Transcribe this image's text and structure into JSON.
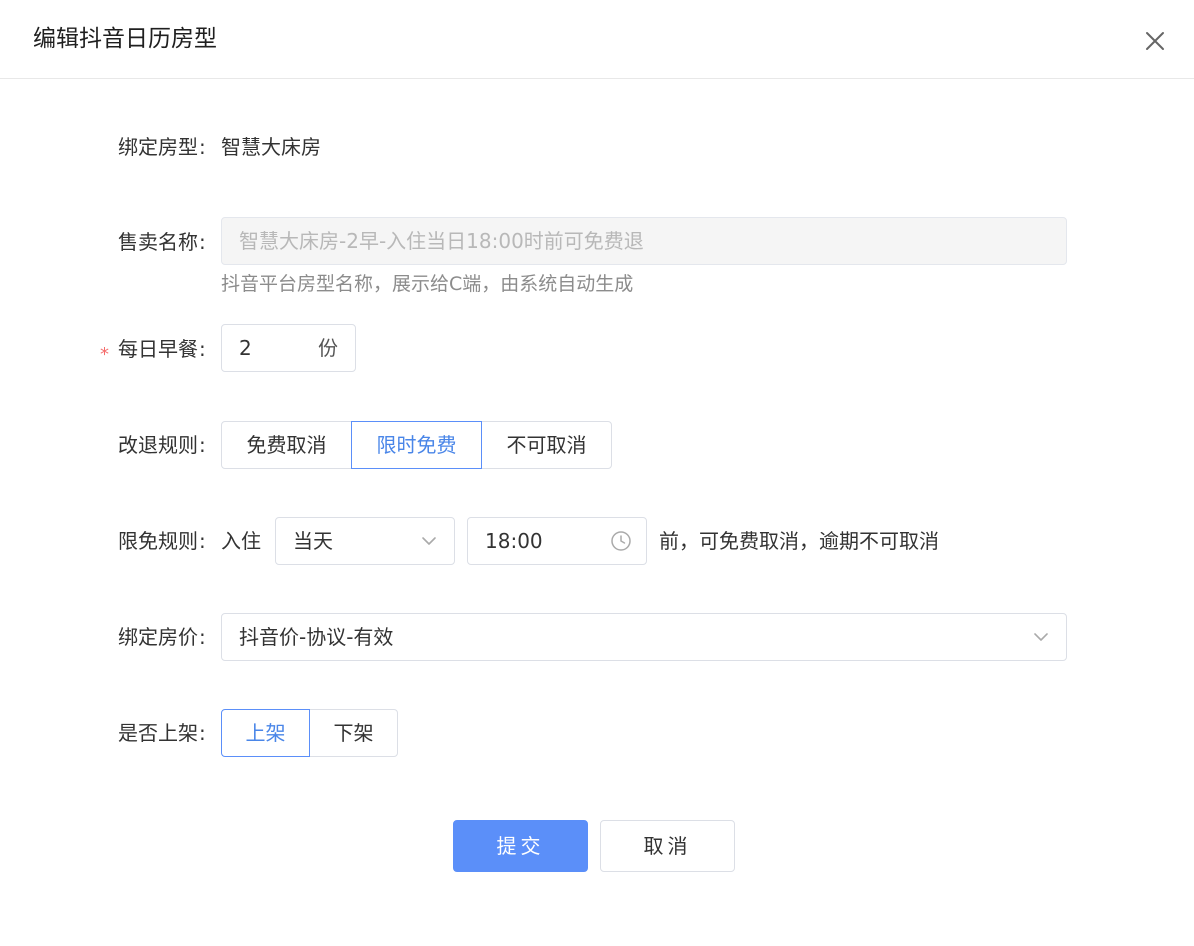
{
  "dialog": {
    "title": "编辑抖音日历房型"
  },
  "form": {
    "room_type": {
      "label": "绑定房型",
      "value": "智慧大床房"
    },
    "sale_name": {
      "label": "售卖名称",
      "placeholder": "智慧大床房-2早-入住当日18:00时前可免费退",
      "hint": "抖音平台房型名称，展示给C端，由系统自动生成"
    },
    "breakfast": {
      "label": "每日早餐",
      "required_mark": "*",
      "value": "2",
      "unit": "份"
    },
    "cancel_rule": {
      "label": "改退规则",
      "options": [
        "免费取消",
        "限时免费",
        "不可取消"
      ],
      "selected": "限时免费"
    },
    "free_rule": {
      "label": "限免规则",
      "prefix": "入住",
      "day_value": "当天",
      "time_value": "18:00",
      "suffix": "前，可免费取消，逾期不可取消"
    },
    "price": {
      "label": "绑定房价",
      "value": "抖音价-协议-有效"
    },
    "listing": {
      "label": "是否上架",
      "options": [
        "上架",
        "下架"
      ],
      "selected": "上架"
    }
  },
  "actions": {
    "submit": "提交",
    "cancel": "取消"
  },
  "colors": {
    "accent": "#5b8ff9",
    "required": "#f56c6c",
    "border": "#dcdfe6"
  },
  "icons": {
    "close": "close-icon",
    "select_arrow": "chevron-down-icon",
    "time": "clock-icon"
  }
}
